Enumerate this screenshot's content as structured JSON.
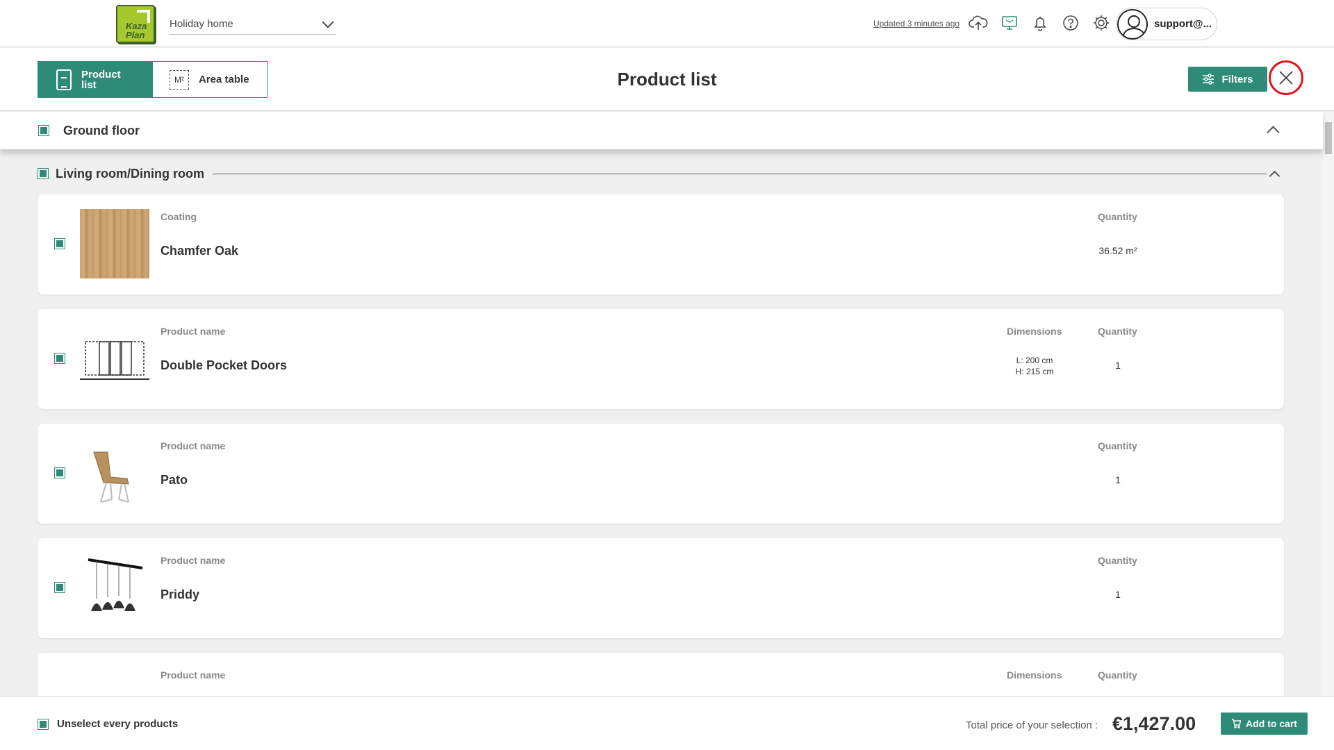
{
  "header": {
    "logo_text": "Kaza Plan",
    "project_name": "Holiday home",
    "updated_text": "Updated 3 minutes ago",
    "icons": [
      "cloud-upload-icon",
      "monitor-icon",
      "bell-icon",
      "help-icon",
      "settings-icon"
    ],
    "user_name": "support@..."
  },
  "subheader": {
    "tabs": [
      {
        "label": "Product list",
        "icon": "clipboard-icon",
        "active": true
      },
      {
        "label": "Area table",
        "icon": "m2-icon",
        "icon_text": "M²",
        "active": false
      }
    ],
    "title": "Product list",
    "filters_label": "Filters"
  },
  "floor": {
    "label": "Ground floor",
    "checked": true
  },
  "room": {
    "label": "Living room/Dining room",
    "checked": true
  },
  "items": [
    {
      "col_label": "Coating",
      "name": "Chamfer Oak",
      "quantity_label": "Quantity",
      "quantity": "36.52 m²",
      "thumb": "oak-texture"
    },
    {
      "col_label": "Product name",
      "name": "Double Pocket Doors",
      "dimensions_label": "Dimensions",
      "dim_l": "L: 200 cm",
      "dim_h": "H: 215 cm",
      "quantity_label": "Quantity",
      "quantity": "1",
      "thumb": "pocket-door-drawing"
    },
    {
      "col_label": "Product name",
      "name": "Pato",
      "quantity_label": "Quantity",
      "quantity": "1",
      "thumb": "chair-photo"
    },
    {
      "col_label": "Product name",
      "name": "Priddy",
      "quantity_label": "Quantity",
      "quantity": "1",
      "thumb": "pendant-lamp-photo"
    },
    {
      "col_label": "Product name",
      "dimensions_label": "Dimensions",
      "quantity_label": "Quantity"
    }
  ],
  "footer": {
    "unselect_label": "Unselect every products",
    "total_label": "Total price of your selection :",
    "total_value": "€1,427.00",
    "cart_label": "Add to cart"
  },
  "colors": {
    "accent": "#2e8b77",
    "logo_green": "#a5c82d",
    "close_highlight": "#e0141c"
  }
}
